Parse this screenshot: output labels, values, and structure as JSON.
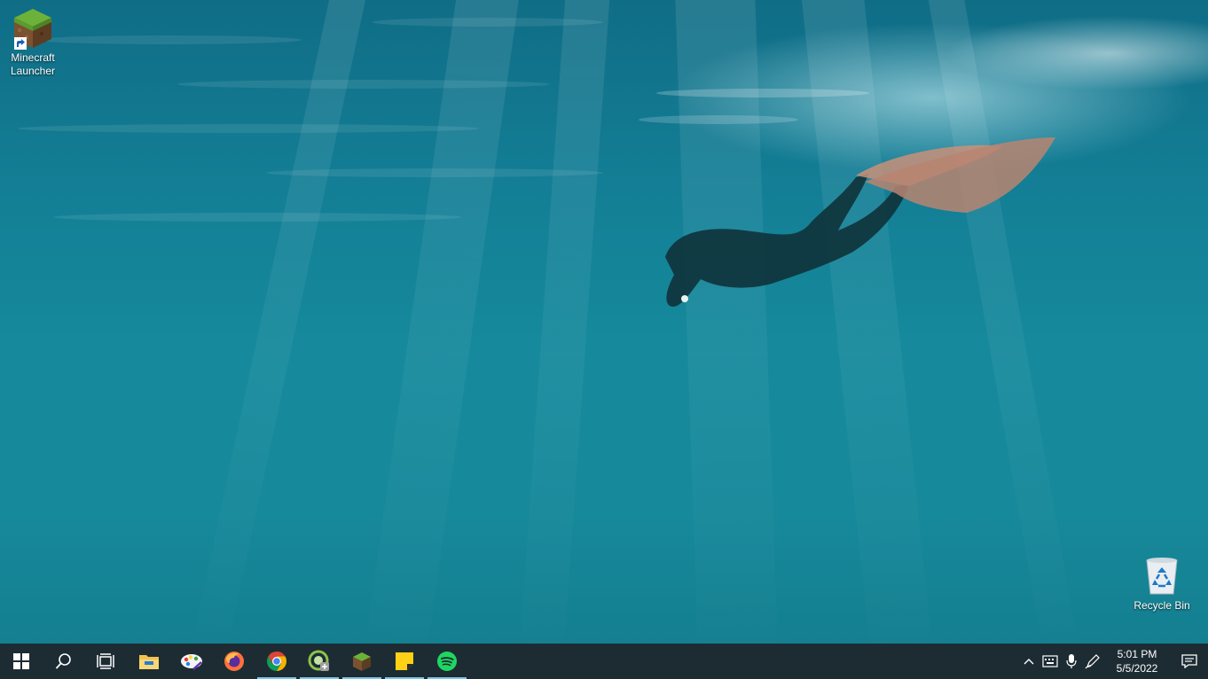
{
  "desktop": {
    "wallpaper": "underwater-freediver",
    "icons": [
      {
        "label": "Minecraft Launcher",
        "icon": "minecraft-grass-block-icon"
      },
      {
        "label": "Recycle Bin",
        "icon": "recycle-bin-icon"
      }
    ]
  },
  "taskbar": {
    "color": "#1d2c33",
    "start": {
      "icon": "windows-start-icon"
    },
    "search": {
      "icon": "search-icon"
    },
    "task_view": {
      "icon": "task-view-icon"
    },
    "pinned": [
      {
        "name": "File Explorer",
        "icon": "folder-icon",
        "running": false
      },
      {
        "name": "Paint",
        "icon": "paint-palette-icon",
        "running": false
      },
      {
        "name": "Firefox",
        "icon": "firefox-icon",
        "running": false
      },
      {
        "name": "Chrome",
        "icon": "chrome-icon",
        "running": true
      },
      {
        "name": "App",
        "icon": "green-circle-app-icon",
        "running": true
      },
      {
        "name": "Minecraft",
        "icon": "minecraft-grass-block-icon",
        "running": true
      },
      {
        "name": "Sticky Notes",
        "icon": "sticky-notes-icon",
        "running": true
      },
      {
        "name": "Spotify",
        "icon": "spotify-icon",
        "running": true
      }
    ],
    "tray": {
      "icons": [
        "chevron-up-icon",
        "keyboard-icon",
        "microphone-icon",
        "pen-icon"
      ],
      "time": "5:01 PM",
      "date": "5/5/2022",
      "notification_icon": "notification-icon"
    },
    "running_indicator_color": "#7fc7e8"
  }
}
